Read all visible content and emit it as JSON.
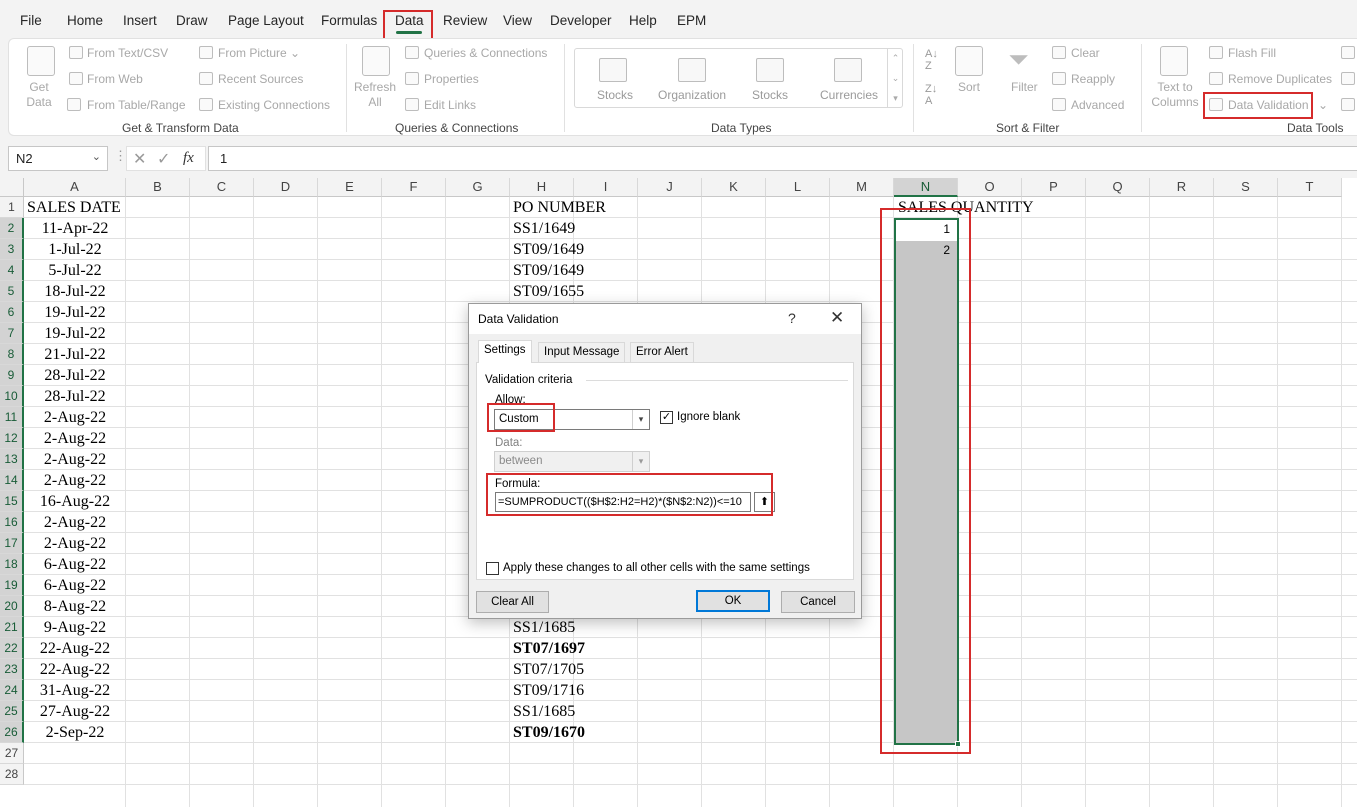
{
  "menu": {
    "tabs": [
      "File",
      "Home",
      "Insert",
      "Draw",
      "Page Layout",
      "Formulas",
      "Data",
      "Review",
      "View",
      "Developer",
      "Help",
      "EPM"
    ],
    "active_tab": "Data"
  },
  "ribbon": {
    "get_transform": {
      "get_data": "Get\nData",
      "from_text_csv": "From Text/CSV",
      "from_web": "From Web",
      "from_table_range": "From Table/Range",
      "from_picture": "From Picture",
      "recent_sources": "Recent Sources",
      "existing_connections": "Existing Connections",
      "label": "Get & Transform Data"
    },
    "queries": {
      "refresh_all": "Refresh\nAll",
      "queries_connections": "Queries & Connections",
      "properties": "Properties",
      "edit_links": "Edit Links",
      "label": "Queries & Connections"
    },
    "data_types": {
      "items": [
        "Stocks",
        "Organization",
        "Stocks",
        "Currencies"
      ],
      "label": "Data Types"
    },
    "sort_filter": {
      "sort": "Sort",
      "filter": "Filter",
      "clear": "Clear",
      "reapply": "Reapply",
      "advanced": "Advanced",
      "label": "Sort & Filter"
    },
    "data_tools": {
      "text_to_columns": "Text to\nColumns",
      "flash_fill": "Flash Fill",
      "remove_duplicates": "Remove Duplicates",
      "data_validation": "Data Validation",
      "label": "Data Tools"
    }
  },
  "formula_bar": {
    "name_box": "N2",
    "fx": "fx",
    "value": "1"
  },
  "sheet": {
    "columns": [
      "A",
      "B",
      "C",
      "D",
      "E",
      "F",
      "G",
      "H",
      "I",
      "J",
      "K",
      "L",
      "M",
      "N",
      "O",
      "P",
      "Q",
      "R",
      "S",
      "T"
    ],
    "rows": [
      1,
      2,
      3,
      4,
      5,
      6,
      7,
      8,
      9,
      10,
      11,
      12,
      13,
      14,
      15,
      16,
      17,
      18,
      19,
      20,
      21,
      22,
      23,
      24,
      25,
      26,
      27,
      28
    ],
    "a1": "SALES DATE",
    "h1": "PO NUMBER",
    "n1": "SALES QUANTITY",
    "sales_dates": [
      "11-Apr-22",
      "1-Jul-22",
      "5-Jul-22",
      "18-Jul-22",
      "19-Jul-22",
      "19-Jul-22",
      "21-Jul-22",
      "28-Jul-22",
      "28-Jul-22",
      "2-Aug-22",
      "2-Aug-22",
      "2-Aug-22",
      "2-Aug-22",
      "16-Aug-22",
      "2-Aug-22",
      "2-Aug-22",
      "6-Aug-22",
      "6-Aug-22",
      "8-Aug-22",
      "9-Aug-22",
      "22-Aug-22",
      "22-Aug-22",
      "31-Aug-22",
      "27-Aug-22",
      "2-Sep-22"
    ],
    "po_top": [
      "SS1/1649",
      "ST09/1649",
      "ST09/1649",
      "ST09/1655"
    ],
    "po_bottom": [
      {
        "value": "SS1/1685",
        "bold": false
      },
      {
        "value": "ST07/1697",
        "bold": true
      },
      {
        "value": "ST07/1705",
        "bold": false
      },
      {
        "value": "ST09/1716",
        "bold": false
      },
      {
        "value": "SS1/1685",
        "bold": false
      },
      {
        "value": "ST09/1670",
        "bold": true
      }
    ],
    "sales_quantity": [
      "1",
      "2"
    ]
  },
  "dialog": {
    "title": "Data Validation",
    "help": "?",
    "close": "✕",
    "tabs": [
      "Settings",
      "Input Message",
      "Error Alert"
    ],
    "active_tab": "Settings",
    "section": "Validation criteria",
    "allow_label": "Allow:",
    "allow_value": "Custom",
    "ignore_blank_label": "Ignore blank",
    "ignore_blank_checked": true,
    "data_label": "Data:",
    "data_value": "between",
    "formula_label": "Formula:",
    "formula_value": "=SUMPRODUCT(($H$2:H2=H2)*($N$2:N2))<=10",
    "apply_label": "Apply these changes to all other cells with the same settings",
    "apply_checked": false,
    "clear_all": "Clear All",
    "ok": "OK",
    "cancel": "Cancel"
  }
}
